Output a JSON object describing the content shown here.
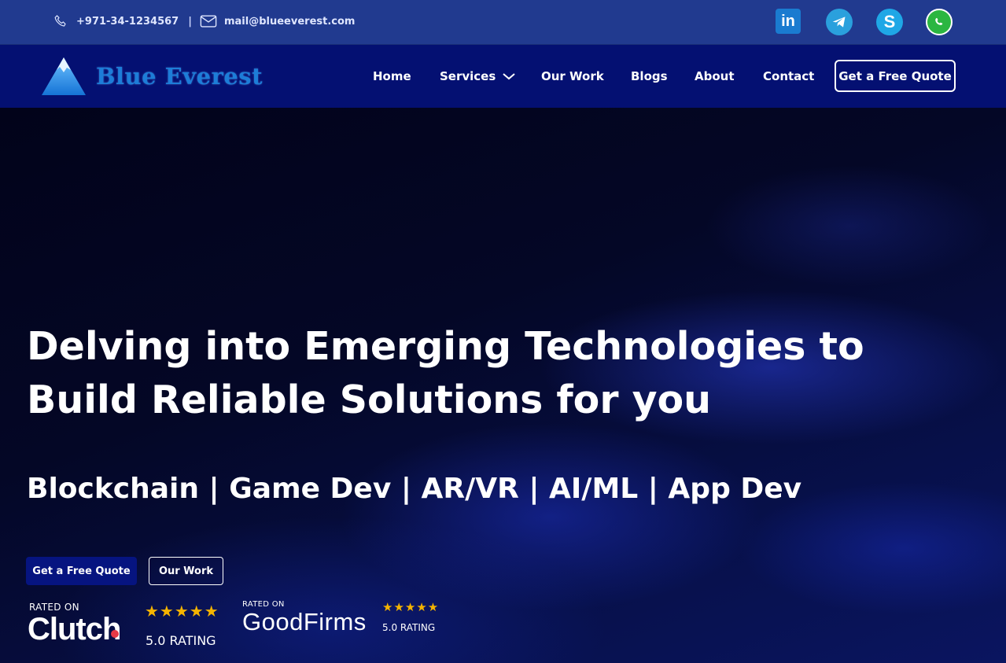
{
  "topbar": {
    "phone": "+971-34-1234567",
    "separator": "|",
    "email": "mail@blueeverest.com",
    "phone_icon": "phone-icon",
    "email_icon": "mail-icon",
    "social": [
      {
        "name": "linkedin-icon",
        "label": "in",
        "color": "#1a7bd0"
      },
      {
        "name": "telegram-icon",
        "label": "",
        "color": "#2aa0dd"
      },
      {
        "name": "skype-icon",
        "label": "S",
        "color": "#1fa7e6"
      },
      {
        "name": "whatsapp-icon",
        "label": "",
        "color": "#2bb641"
      }
    ]
  },
  "nav": {
    "logo_text": "Blue Everest",
    "items": [
      {
        "label": "Home"
      },
      {
        "label": "Services"
      },
      {
        "label": "Our Work"
      },
      {
        "label": "Blogs"
      },
      {
        "label": "About"
      },
      {
        "label": "Contact"
      }
    ],
    "cta": "Get a Free Quote"
  },
  "hero": {
    "title": "Delving into Emerging Technologies to Build Reliable Solutions for you",
    "subtitle": "Blockchain | Game Dev | AR/VR | AI/ML | App Dev",
    "primary_button": "Get a Free Quote",
    "secondary_button": "Our Work"
  },
  "ratings": {
    "clutch": {
      "rated_on": "RATED ON",
      "brand": "Clutch",
      "stars": "★★★★★",
      "rating": "5.0 RATING"
    },
    "goodfirms": {
      "rated_on": "RATED ON",
      "brand": "GoodFirms",
      "stars": "★★★★★",
      "rating": "5.0 RATING"
    }
  },
  "colors": {
    "topbar": "#213a8f",
    "navbar": "#041072",
    "accent": "#061480",
    "star": "#f5b400"
  }
}
